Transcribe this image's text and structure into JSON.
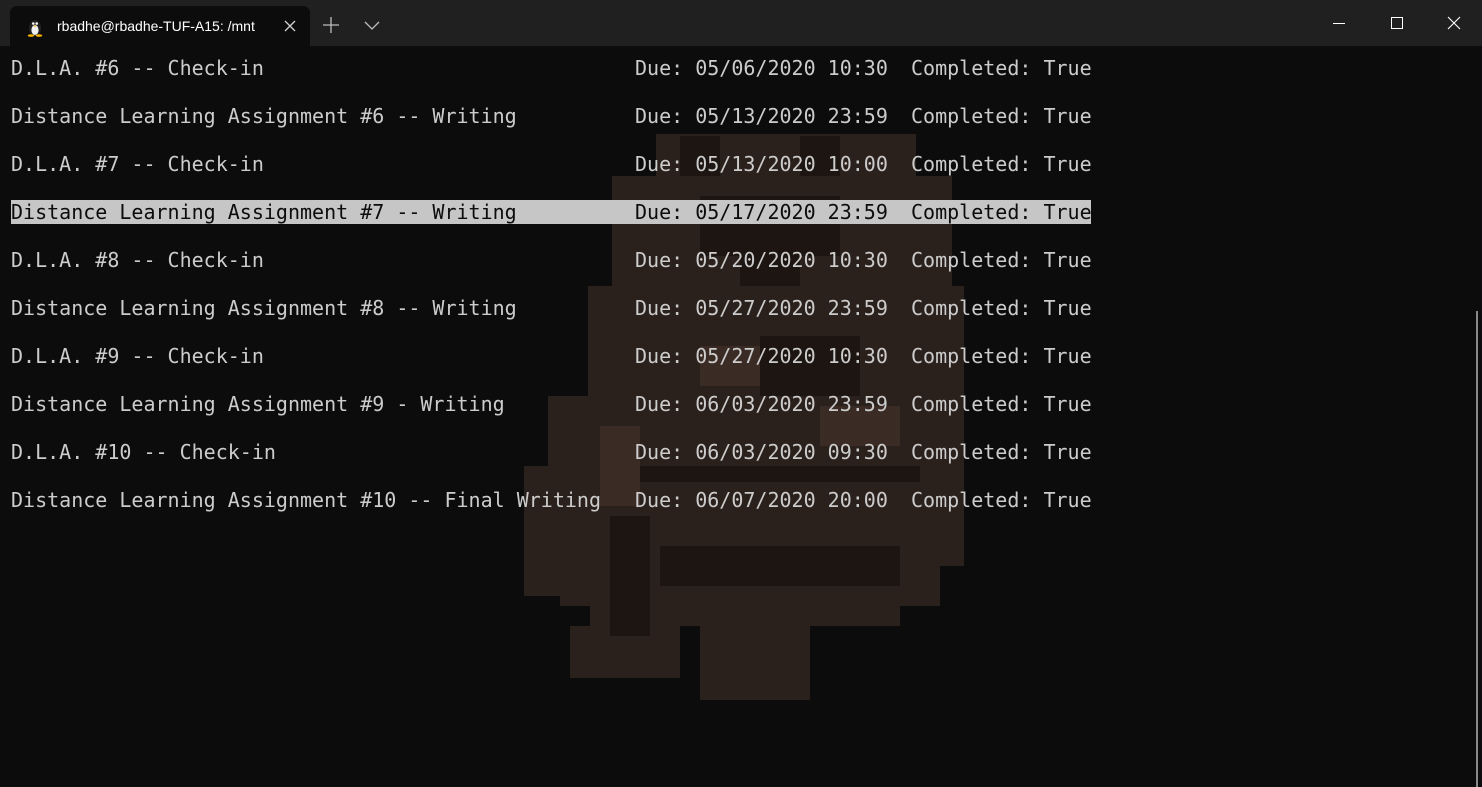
{
  "window": {
    "tab_title": "rbadhe@rbadhe-TUF-A15: /mnt",
    "tab_icon": "linux-penguin-icon"
  },
  "terminal": {
    "rows": [
      {
        "name": "D.L.A. #6 -- Check-in",
        "due": "Due: 05/06/2020 10:30",
        "completed": "Completed: True",
        "selected": false
      },
      {
        "name": "Distance Learning Assignment #6 -- Writing",
        "due": "Due: 05/13/2020 23:59",
        "completed": "Completed: True",
        "selected": false
      },
      {
        "name": "D.L.A. #7 -- Check-in",
        "due": "Due: 05/13/2020 10:00",
        "completed": "Completed: True",
        "selected": false
      },
      {
        "name": "Distance Learning Assignment #7 -- Writing",
        "due": "Due: 05/17/2020 23:59",
        "completed": "Completed: True",
        "selected": true
      },
      {
        "name": "D.L.A. #8 -- Check-in",
        "due": "Due: 05/20/2020 10:30",
        "completed": "Completed: True",
        "selected": false
      },
      {
        "name": "Distance Learning Assignment #8 -- Writing",
        "due": "Due: 05/27/2020 23:59",
        "completed": "Completed: True",
        "selected": false
      },
      {
        "name": "D.L.A. #9 -- Check-in",
        "due": "Due: 05/27/2020 10:30",
        "completed": "Completed: True",
        "selected": false
      },
      {
        "name": "Distance Learning Assignment #9 - Writing",
        "due": "Due: 06/03/2020 23:59",
        "completed": "Completed: True",
        "selected": false
      },
      {
        "name": "D.L.A. #10 -- Check-in",
        "due": "Due: 06/03/2020 09:30",
        "completed": "Completed: True",
        "selected": false
      },
      {
        "name": "Distance Learning Assignment #10 -- Final Writing",
        "due": "Due: 06/07/2020 20:00",
        "completed": "Completed: True",
        "selected": false
      }
    ]
  },
  "colors": {
    "terminal_bg": "#0c0c0c",
    "titlebar_bg": "#202020",
    "text": "#cccccc",
    "selection_bg": "#c6c6c6"
  }
}
